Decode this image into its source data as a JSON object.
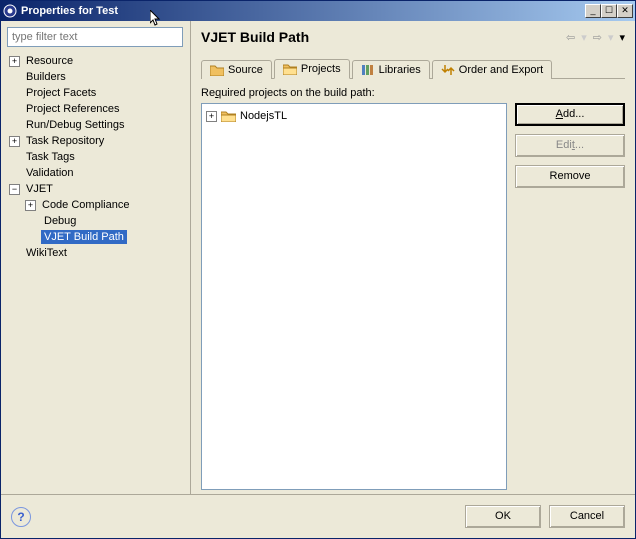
{
  "titlebar": {
    "title": "Properties for Test"
  },
  "filter": {
    "placeholder": "type filter text"
  },
  "tree": {
    "resource": "Resource",
    "builders": "Builders",
    "project_facets": "Project Facets",
    "project_references": "Project References",
    "run_debug": "Run/Debug Settings",
    "task_repository": "Task Repository",
    "task_tags": "Task Tags",
    "validation": "Validation",
    "vjet": "VJET",
    "vjet_children": {
      "code_compliance": "Code Compliance",
      "debug": "Debug",
      "build_path": "VJET Build Path"
    },
    "wikitext": "WikiText"
  },
  "main": {
    "heading": "VJET Build Path",
    "tabs": {
      "source": "Source",
      "projects": "Projects",
      "libraries": "Libraries",
      "order_export": "Order and Export"
    },
    "required_label_pre": "Re",
    "required_label_mn": "q",
    "required_label_post": "uired projects on the build path:",
    "projects_list": [
      {
        "name": "NodejsTL"
      }
    ],
    "buttons": {
      "add_pre": "",
      "add_mn": "A",
      "add_post": "dd...",
      "edit_pre": "Edi",
      "edit_mn": "t",
      "edit_post": "...",
      "remove": "Remove"
    }
  },
  "footer": {
    "ok": "OK",
    "cancel": "Cancel"
  }
}
